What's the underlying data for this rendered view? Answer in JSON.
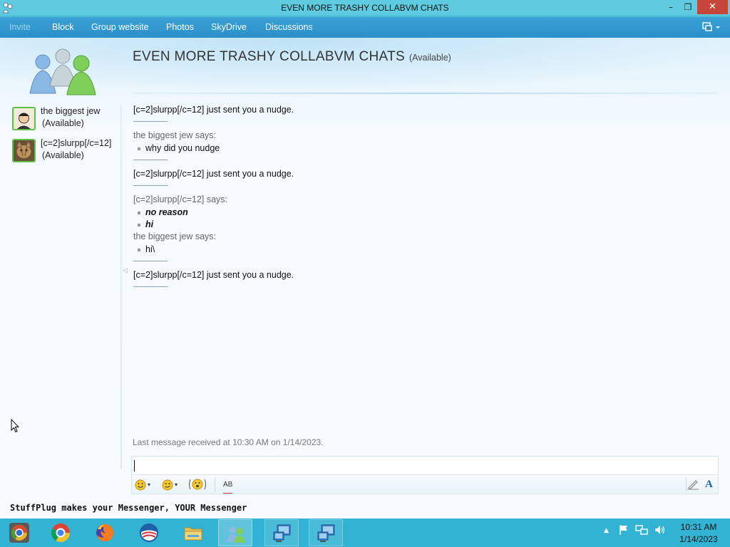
{
  "window": {
    "title": "EVEN MORE TRASHY COLLABVM CHATS",
    "controls": {
      "minimize": "–",
      "maximize": "❐",
      "close": "✕"
    }
  },
  "menubar": {
    "items": [
      {
        "label": "Invite",
        "enabled": false
      },
      {
        "label": "Block",
        "enabled": true
      },
      {
        "label": "Group website",
        "enabled": true
      },
      {
        "label": "Photos",
        "enabled": true
      },
      {
        "label": "SkyDrive",
        "enabled": true
      },
      {
        "label": "Discussions",
        "enabled": true
      }
    ],
    "options_icon": "options-menu-icon"
  },
  "conversation": {
    "title": "EVEN MORE TRASHY COLLABVM CHATS",
    "status": "(Available)"
  },
  "contacts": [
    {
      "name": "the biggest jew",
      "status": "(Available)",
      "avatar_icon": "person-cartoon-avatar"
    },
    {
      "name": "[c=2]slurpp[/c=12]",
      "status": "(Available)",
      "avatar_icon": "cat-photo-avatar"
    }
  ],
  "messages": [
    {
      "type": "nudge",
      "text": "[c=2]slurpp[/c=12] just sent you a nudge."
    },
    {
      "type": "says",
      "text": "the biggest jew says:"
    },
    {
      "type": "item",
      "text": "why did you nudge",
      "style": "normal"
    },
    {
      "type": "nudge",
      "text": "[c=2]slurpp[/c=12] just sent you a nudge."
    },
    {
      "type": "says",
      "text": "[c=2]slurpp[/c=12] says:"
    },
    {
      "type": "item",
      "text": "no reason",
      "style": "bold-italic"
    },
    {
      "type": "item",
      "text": "hi",
      "style": "bold-italic"
    },
    {
      "type": "says",
      "text": "the biggest jew says:"
    },
    {
      "type": "item",
      "text": "hi\\",
      "style": "normal"
    },
    {
      "type": "nudge",
      "text": "[c=2]slurpp[/c=12] just sent you a nudge."
    }
  ],
  "status_line": "Last message received at 10:30 AM on 1/14/2023.",
  "input": {
    "value": ""
  },
  "input_toolbar": {
    "emoticon_icon": "smiley-icon",
    "wink_icon": "wink-icon",
    "nudge_icon": "nudge-icon",
    "spell_label": "AB",
    "font_label": "A"
  },
  "ad_banner": "StuffPlug makes your Messenger, YOUR Messenger",
  "taskbar": {
    "apps": [
      {
        "name": "chrome-canary",
        "state": "pinned"
      },
      {
        "name": "chrome",
        "state": "pinned"
      },
      {
        "name": "firefox",
        "state": "pinned"
      },
      {
        "name": "obama-campaign",
        "state": "pinned"
      },
      {
        "name": "file-explorer",
        "state": "pinned"
      },
      {
        "name": "windows-live-messenger",
        "state": "active"
      },
      {
        "name": "remote-desktop-1",
        "state": "open"
      },
      {
        "name": "remote-desktop-2",
        "state": "open"
      }
    ],
    "time": "10:31 AM",
    "date": "1/14/2023"
  },
  "colors": {
    "menubar": "#2b8fc9",
    "taskbar": "#33b3d3",
    "close_button": "#c7463c",
    "contact_border": "#5cc146"
  }
}
